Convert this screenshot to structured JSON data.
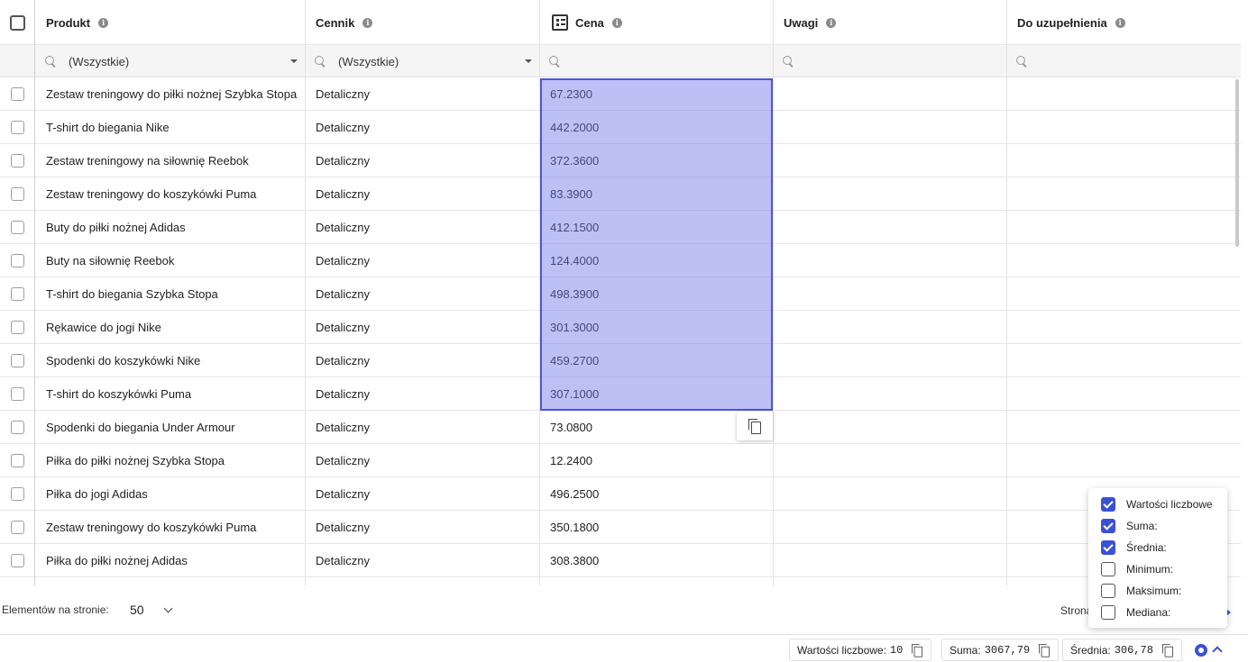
{
  "header": {
    "product": "Produkt",
    "pricelist": "Cennik",
    "price": "Cena",
    "notes": "Uwagi",
    "todo": "Do uzupełnienia"
  },
  "filters": {
    "product": "(Wszystkie)",
    "pricelist": "(Wszystkie)"
  },
  "rows": [
    {
      "product": "Zestaw treningowy do piłki nożnej Szybka Stopa",
      "pricelist": "Detaliczny",
      "price": "67.2300"
    },
    {
      "product": "T-shirt do biegania Nike",
      "pricelist": "Detaliczny",
      "price": "442.2000"
    },
    {
      "product": "Zestaw treningowy na siłownię Reebok",
      "pricelist": "Detaliczny",
      "price": "372.3600"
    },
    {
      "product": "Zestaw treningowy do koszykówki Puma",
      "pricelist": "Detaliczny",
      "price": "83.3900"
    },
    {
      "product": "Buty do piłki nożnej Adidas",
      "pricelist": "Detaliczny",
      "price": "412.1500"
    },
    {
      "product": "Buty na siłownię Reebok",
      "pricelist": "Detaliczny",
      "price": "124.4000"
    },
    {
      "product": "T-shirt do biegania Szybka Stopa",
      "pricelist": "Detaliczny",
      "price": "498.3900"
    },
    {
      "product": "Rękawice do jogi Nike",
      "pricelist": "Detaliczny",
      "price": "301.3000"
    },
    {
      "product": "Spodenki do koszykówki Nike",
      "pricelist": "Detaliczny",
      "price": "459.2700"
    },
    {
      "product": "T-shirt do koszykówki Puma",
      "pricelist": "Detaliczny",
      "price": "307.1000"
    },
    {
      "product": "Spodenki do biegania Under Armour",
      "pricelist": "Detaliczny",
      "price": "73.0800"
    },
    {
      "product": "Piłka do piłki nożnej Szybka Stopa",
      "pricelist": "Detaliczny",
      "price": "12.2400"
    },
    {
      "product": "Piłka do jogi Adidas",
      "pricelist": "Detaliczny",
      "price": "496.2500"
    },
    {
      "product": "Zestaw treningowy do koszykówki Puma",
      "pricelist": "Detaliczny",
      "price": "350.1800"
    },
    {
      "product": "Piłka do piłki nożnej Adidas",
      "pricelist": "Detaliczny",
      "price": "308.3800"
    }
  ],
  "pagination": {
    "per_page_label": "Elementów na stronie:",
    "per_page_value": "50",
    "page_label": "Strona"
  },
  "stats_menu": [
    {
      "label": "Wartości liczbowe",
      "checked": true
    },
    {
      "label": "Suma:",
      "checked": true
    },
    {
      "label": "Średnia:",
      "checked": true
    },
    {
      "label": "Minimum:",
      "checked": false
    },
    {
      "label": "Maksimum:",
      "checked": false
    },
    {
      "label": "Mediana:",
      "checked": false
    }
  ],
  "stats": {
    "count_label": "Wartości liczbowe:",
    "count_value": "10",
    "sum_label": "Suma:",
    "sum_value": "3067,79",
    "avg_label": "Średnia:",
    "avg_value": "306,78"
  },
  "colors": {
    "accent": "#3c50d6",
    "selection_fill": "#b3b7f1",
    "selection_border": "#4c57d6"
  },
  "icons": [
    "info-icon",
    "search-icon",
    "list-icon",
    "copy-icon",
    "gear-icon",
    "chevron-down-icon",
    "chevron-up-icon"
  ]
}
